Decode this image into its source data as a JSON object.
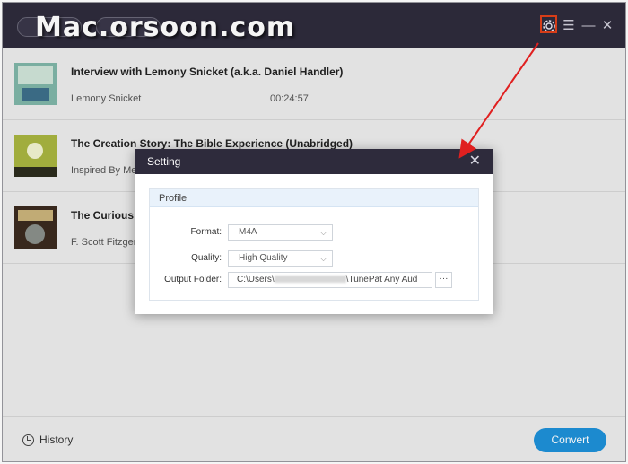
{
  "watermark": "Mac.orsoon.com",
  "titlebar": {
    "icons": [
      "settings-icon",
      "menu-icon",
      "minimize-icon",
      "close-icon"
    ]
  },
  "items": [
    {
      "title": "Interview with Lemony Snicket (a.k.a. Daniel Handler)",
      "author": "Lemony Snicket",
      "duration": "00:24:57"
    },
    {
      "title": "The Creation Story: The Bible Experience (Unabridged)",
      "author": "Inspired By Me",
      "duration": ""
    },
    {
      "title": "The Curious",
      "author": "F. Scott Fitzgera",
      "duration": ""
    }
  ],
  "footer": {
    "history_label": "History",
    "convert_label": "Convert"
  },
  "dialog": {
    "title": "Setting",
    "section": "Profile",
    "format_label": "Format:",
    "format_value": "M4A",
    "quality_label": "Quality:",
    "quality_value": "High Quality",
    "folder_label": "Output Folder:",
    "folder_prefix": "C:\\Users\\",
    "folder_suffix": "\\TunePat Any Aud",
    "browse_label": "···"
  },
  "colors": {
    "titlebar_bg": "#2e2b3c",
    "accent_blue": "#1e90d8",
    "highlight_red": "#e0401a"
  }
}
